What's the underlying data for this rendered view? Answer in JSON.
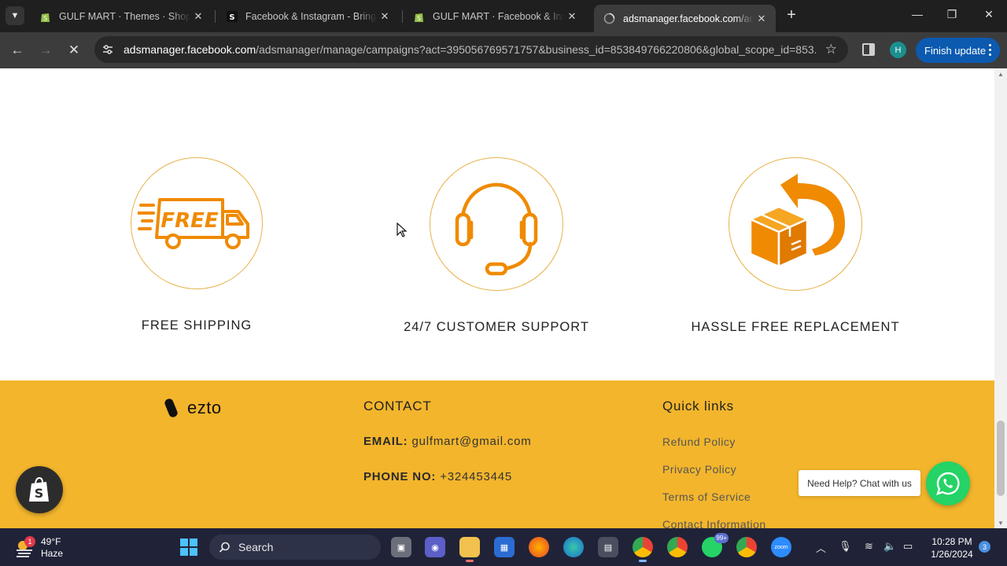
{
  "browser": {
    "tabs": [
      {
        "title": "GULF MART · Themes · Shopify",
        "icon": "shopify-icon",
        "active": false
      },
      {
        "title": "Facebook & Instagram - Bring y",
        "icon": "shopify-s-icon",
        "active": false
      },
      {
        "title": "GULF MART · Facebook & Instagram",
        "icon": "shopify-icon",
        "active": false
      },
      {
        "title": "adsmanager.facebook.com/ads",
        "icon": "loading-globe-icon",
        "active": true
      }
    ],
    "url_host": "adsmanager.facebook.com",
    "url_path": "/adsmanager/manage/campaigns?act=395056769571757&business_id=853849766220806&global_scope_id=853...",
    "profile_initial": "H",
    "finish_update_label": "Finish update"
  },
  "features": [
    {
      "label": "FREE SHIPPING",
      "icon": "free-delivery-truck-icon",
      "icon_text": "FREE"
    },
    {
      "label": "24/7 CUSTOMER SUPPORT",
      "icon": "headset-icon"
    },
    {
      "label": "HASSLE FREE REPLACEMENT",
      "icon": "box-return-icon"
    }
  ],
  "footer": {
    "brand_name": "ezto",
    "contact_heading": "CONTACT",
    "email_label": "EMAIL:",
    "email_value": "gulfmart@gmail.com",
    "phone_label": "PHONE NO:",
    "phone_value": "+324453445",
    "quick_links_heading": "Quick links",
    "quick_links": [
      "Refund Policy",
      "Privacy Policy",
      "Terms of Service",
      "Contact Information"
    ]
  },
  "widgets": {
    "chat_prompt": "Need Help? Chat with us"
  },
  "taskbar": {
    "weather_temp": "49°F",
    "weather_desc": "Haze",
    "weather_badge": "1",
    "search_label": "Search",
    "badge_99": "99+",
    "time": "10:28 PM",
    "date": "1/26/2024",
    "notifications": "3"
  },
  "colors": {
    "accent_orange": "#f08a00",
    "footer_yellow": "#f3b52c",
    "whatsapp_green": "#25d366",
    "browser_dark": "#1f1f1f"
  }
}
